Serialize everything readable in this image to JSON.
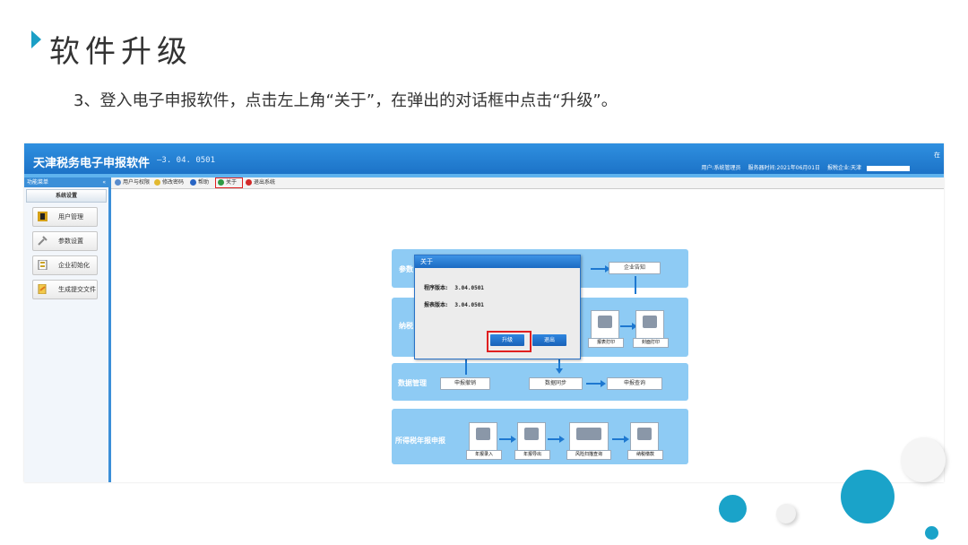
{
  "slide": {
    "title": "软件升级",
    "instruction": "3、登入电子申报软件，点击左上角“关于”，在弹出的对话框中点击“升级”。"
  },
  "app": {
    "name": "天津税务电子申报软件",
    "version": "—3. 04. 0501",
    "status": {
      "user": "用户:系统管理员",
      "server_time": "服务器时间:2021年06月01日",
      "enterprise": "报税企业:天津"
    },
    "corner_text": "在"
  },
  "sidebar": {
    "header": "功能菜单",
    "collapse": "«",
    "group": "系统设置",
    "items": [
      {
        "label": "用户管理",
        "icon": "user-icon"
      },
      {
        "label": "参数设置",
        "icon": "wrench-icon"
      },
      {
        "label": "企业初始化",
        "icon": "building-icon"
      },
      {
        "label": "生成提交文件",
        "icon": "document-icon"
      }
    ]
  },
  "toolbar": {
    "items": [
      {
        "label": "用户与权限",
        "icon": "user-icon"
      },
      {
        "label": "修改密码",
        "icon": "key-icon"
      },
      {
        "label": "帮助",
        "icon": "help-icon"
      },
      {
        "label": "关于",
        "icon": "about-icon"
      },
      {
        "label": "退出系统",
        "icon": "close-icon"
      }
    ]
  },
  "flow": {
    "panel1": {
      "label": "参数",
      "button": "企业告知"
    },
    "panel2": {
      "label": "纳税",
      "boxes": [
        "报表打印",
        "封面打印"
      ]
    },
    "panel3": {
      "label": "数据管理",
      "buttons": [
        "申报撤销",
        "数据同步",
        "申报查询"
      ]
    },
    "panel4": {
      "label": "所得税年报申报",
      "boxes": [
        "年报录入",
        "年报导出",
        "风险扫描查询",
        "纳税缴款"
      ]
    }
  },
  "dialog": {
    "title": "关于",
    "program_version_label": "程序版本:",
    "program_version": "3.04.0501",
    "template_version_label": "报表版本:",
    "template_version": "3.04.0501",
    "upgrade_button": "升级",
    "exit_button": "退出"
  },
  "colors": {
    "accent": "#1b9fc6",
    "title_bar": "#1a6fc4",
    "highlight": "#e02020",
    "panel": "#8ecbf4"
  }
}
